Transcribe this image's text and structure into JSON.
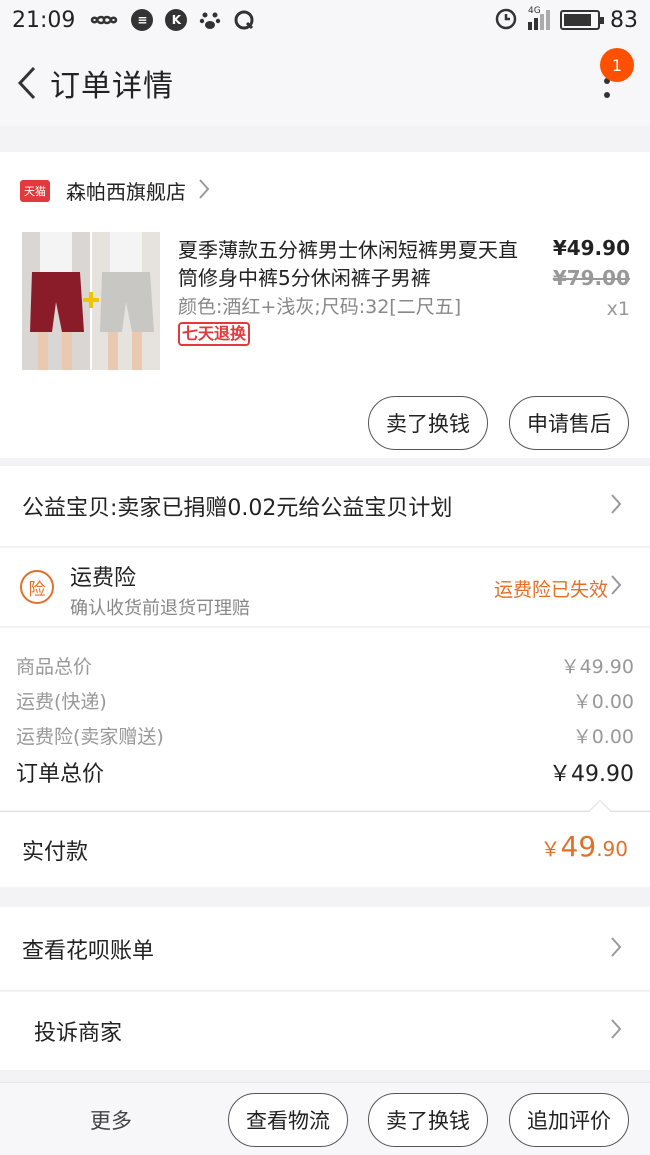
{
  "status_bar": {
    "time": "21:09",
    "network": "4G",
    "battery": "83",
    "battery_level": 0.83
  },
  "header": {
    "title": "订单详情",
    "notification_count": "1"
  },
  "shop": {
    "logo_text": "天猫",
    "name": "森帕西旗舰店"
  },
  "item": {
    "title": "夏季薄款五分裤男士休闲短裤男夏天直筒修身中裤5分休闲裤子男裤",
    "spec": "颜色:酒红+浅灰;尺码:32[二尺五]",
    "tag": "七天退换",
    "price": "¥49.90",
    "original_price": "¥79.00",
    "quantity": "x1",
    "actions": [
      "卖了换钱",
      "申请售后"
    ]
  },
  "charity": {
    "label": "公益宝贝:卖家已捐赠0.02元给公益宝贝计划"
  },
  "insurance": {
    "icon_text": "险",
    "title": "运费险",
    "subtitle": "确认收货前退货可理赔",
    "status": "运费险已失效"
  },
  "price_summary": [
    {
      "label": "商品总价",
      "value": "￥49.90"
    },
    {
      "label": "运费(快递)",
      "value": "￥0.00"
    },
    {
      "label": "运费险(卖家赠送)",
      "value": "￥0.00"
    }
  ],
  "order_total": {
    "label": "订单总价",
    "value": "￥49.90"
  },
  "paid": {
    "label": "实付款",
    "currency": "￥",
    "integer": "49",
    "decimal": ".90"
  },
  "links": [
    {
      "label": "查看花呗账单"
    },
    {
      "label": "投诉商家"
    }
  ],
  "bottom_bar": {
    "more": "更多",
    "buttons": [
      "查看物流",
      "卖了换钱",
      "追加评价"
    ]
  },
  "colors": {
    "accent_orange": "#e2702a",
    "badge": "#ff5000",
    "tmall_red": "#e4393c",
    "wine_red": "#8a1c2a"
  }
}
